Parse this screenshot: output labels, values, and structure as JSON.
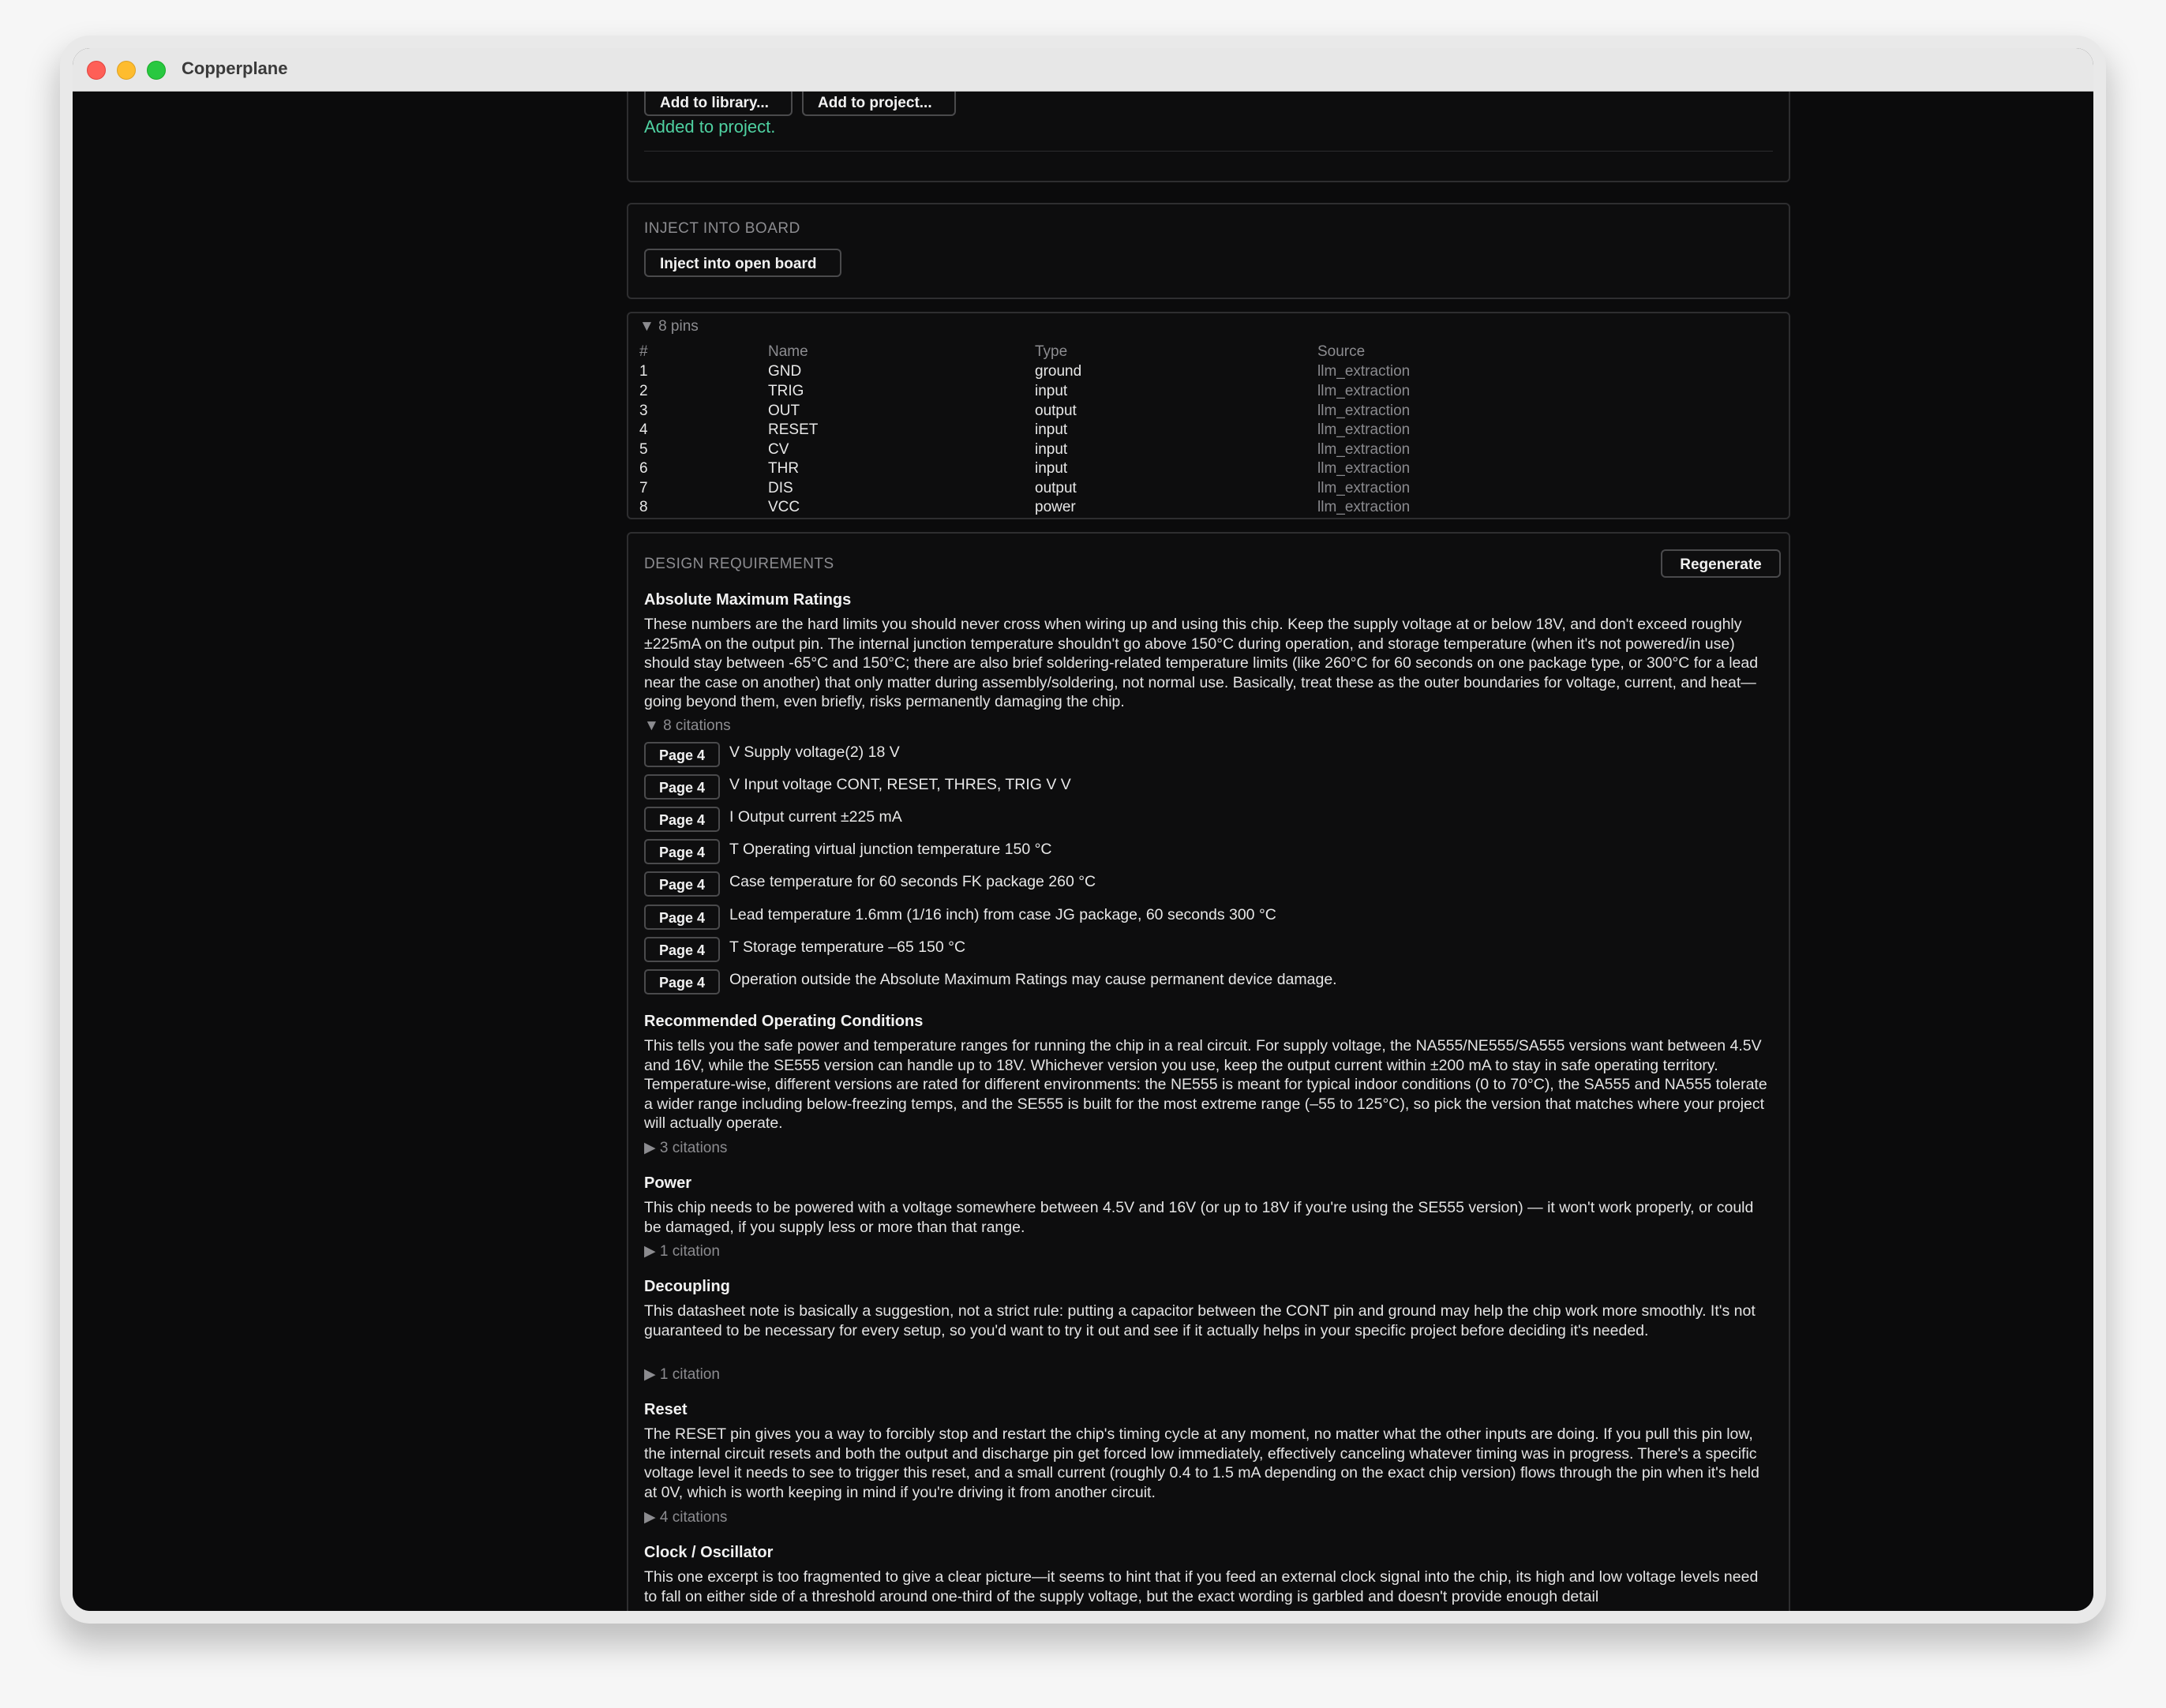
{
  "window": {
    "title": "Copperplane"
  },
  "add_section": {
    "add_library_label": "Add to library...",
    "add_project_label": "Add to project...",
    "status": "Added to project."
  },
  "inject": {
    "heading": "INJECT INTO BOARD",
    "button_label": "Inject into open board"
  },
  "pins": {
    "summary": "▼ 8 pins",
    "headers": {
      "num": "#",
      "name": "Name",
      "type": "Type",
      "source": "Source"
    },
    "rows": [
      {
        "num": "1",
        "name": "GND",
        "type": "ground",
        "source": "llm_extraction"
      },
      {
        "num": "2",
        "name": "TRIG",
        "type": "input",
        "source": "llm_extraction"
      },
      {
        "num": "3",
        "name": "OUT",
        "type": "output",
        "source": "llm_extraction"
      },
      {
        "num": "4",
        "name": "RESET",
        "type": "input",
        "source": "llm_extraction"
      },
      {
        "num": "5",
        "name": "CV",
        "type": "input",
        "source": "llm_extraction"
      },
      {
        "num": "6",
        "name": "THR",
        "type": "input",
        "source": "llm_extraction"
      },
      {
        "num": "7",
        "name": "DIS",
        "type": "output",
        "source": "llm_extraction"
      },
      {
        "num": "8",
        "name": "VCC",
        "type": "power",
        "source": "llm_extraction"
      }
    ]
  },
  "design": {
    "heading": "DESIGN REQUIREMENTS",
    "regenerate_label": "Regenerate",
    "sections": [
      {
        "title": "Absolute Maximum Ratings",
        "body": "These numbers are the hard limits you should never cross when wiring up and using this chip. Keep the supply voltage at or below 18V, and don't exceed roughly ±225mA on the output pin. The internal junction temperature shouldn't go above 150°C during operation, and storage temperature (when it's not powered/in use) should stay between -65°C and 150°C; there are also brief soldering-related temperature limits (like 260°C for 60 seconds on one package type, or 300°C for a lead near the case on another) that only matter during assembly/soldering, not normal use. Basically, treat these as the outer boundaries for voltage, current, and heat—going beyond them, even briefly, risks permanently damaging the chip.",
        "citations_label": "▼ 8 citations",
        "citations": [
          {
            "page": "Page 4",
            "text": "V Supply voltage(2) 18 V"
          },
          {
            "page": "Page 4",
            "text": "V Input voltage CONT, RESET, THRES, TRIG V V"
          },
          {
            "page": "Page 4",
            "text": "I Output current ±225 mA"
          },
          {
            "page": "Page 4",
            "text": "T Operating virtual junction temperature 150 °C"
          },
          {
            "page": "Page 4",
            "text": "Case temperature for 60 seconds FK package 260 °C"
          },
          {
            "page": "Page 4",
            "text": "Lead temperature 1.6mm (1/16 inch) from case JG package, 60 seconds 300 °C"
          },
          {
            "page": "Page 4",
            "text": "T Storage temperature –65 150 °C"
          },
          {
            "page": "Page 4",
            "text": "Operation outside the Absolute Maximum Ratings may cause permanent device damage."
          }
        ]
      },
      {
        "title": "Recommended Operating Conditions",
        "body": "This tells you the safe power and temperature ranges for running the chip in a real circuit. For supply voltage, the NA555/NE555/SA555 versions want between 4.5V and 16V, while the SE555 version can handle up to 18V. Whichever version you use, keep the output current within ±200 mA to stay in safe operating territory. Temperature-wise, different versions are rated for different environments: the NE555 is meant for typical indoor conditions (0 to 70°C), the SA555 and NA555 tolerate a wider range including below-freezing temps, and the SE555 is built for the most extreme range (–55 to 125°C), so pick the version that matches where your project will actually operate.",
        "citations_label": "▶ 3 citations"
      },
      {
        "title": "Power",
        "body": "This chip needs to be powered with a voltage somewhere between 4.5V and 16V (or up to 18V if you're using the SE555 version) — it won't work properly, or could be damaged, if you supply less or more than that range.",
        "citations_label": "▶ 1 citation"
      },
      {
        "title": "Decoupling",
        "body": "This datasheet note is basically a suggestion, not a strict rule: putting a capacitor between the CONT pin and ground may help the chip work more smoothly. It's not guaranteed to be necessary for every setup, so you'd want to try it out and see if it actually helps in your specific project before deciding it's needed.",
        "citations_label": "▶ 1 citation"
      },
      {
        "title": "Reset",
        "body": "The RESET pin gives you a way to forcibly stop and restart the chip's timing cycle at any moment, no matter what the other inputs are doing. If you pull this pin low, the internal circuit resets and both the output and discharge pin get forced low immediately, effectively canceling whatever timing was in progress. There's a specific voltage level it needs to see to trigger this reset, and a small current (roughly 0.4 to 1.5 mA depending on the exact chip version) flows through the pin when it's held at 0V, which is worth keeping in mind if you're driving it from another circuit.",
        "citations_label": "▶ 4 citations"
      },
      {
        "title": "Clock / Oscillator",
        "body": "This one excerpt is too fragmented to give a clear picture—it seems to hint that if you feed an external clock signal into the chip, its high and low voltage levels need to fall on either side of a threshold around one-third of the supply voltage, but the exact wording is garbled and doesn't provide enough detail"
      }
    ]
  }
}
